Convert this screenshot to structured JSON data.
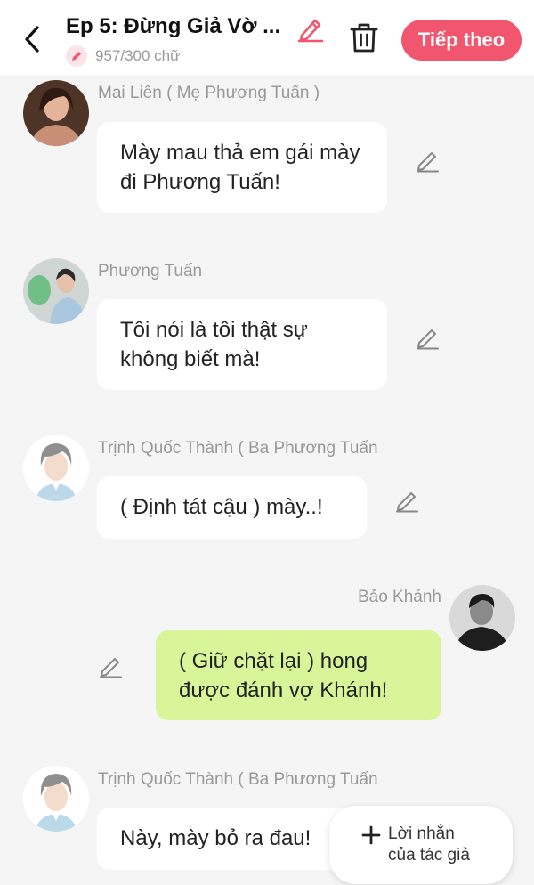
{
  "header": {
    "title": "Ep 5: Đừng Giả Vờ ...",
    "char_count": "957/300 chữ",
    "next_label": "Tiếp theo",
    "accent_color": "#f2566e"
  },
  "messages": [
    {
      "speaker": "Mai Liên ( Mẹ Phương Tuấn )",
      "text": "Mày mau thả em gái mày đi Phương Tuấn!",
      "side": "left",
      "avatar": "woman-portrait"
    },
    {
      "speaker": "Phương Tuấn",
      "text": "Tôi nói là tôi thật sự không biết mà!",
      "side": "left",
      "avatar": "young-man-photo"
    },
    {
      "speaker": "Trịnh Quốc Thành ( Ba Phương Tuấn",
      "text": "( Định tát cậu ) mày..!",
      "side": "left",
      "avatar": "anime-man"
    },
    {
      "speaker": "Bảo Khánh",
      "text": "( Giữ chặt lại ) hong được đánh vợ Khánh!",
      "side": "right",
      "avatar": "man-bw-photo"
    },
    {
      "speaker": "Trịnh Quốc Thành ( Ba Phương Tuấn",
      "text": "Này, mày bỏ ra đau!",
      "side": "left",
      "avatar": "anime-man"
    }
  ],
  "author_note": {
    "label": "Lời nhắn\ncủa tác giả"
  },
  "icons": {
    "back": "back-arrow-icon",
    "edit": "pencil-icon",
    "delete": "trash-icon",
    "add": "plus-icon"
  }
}
